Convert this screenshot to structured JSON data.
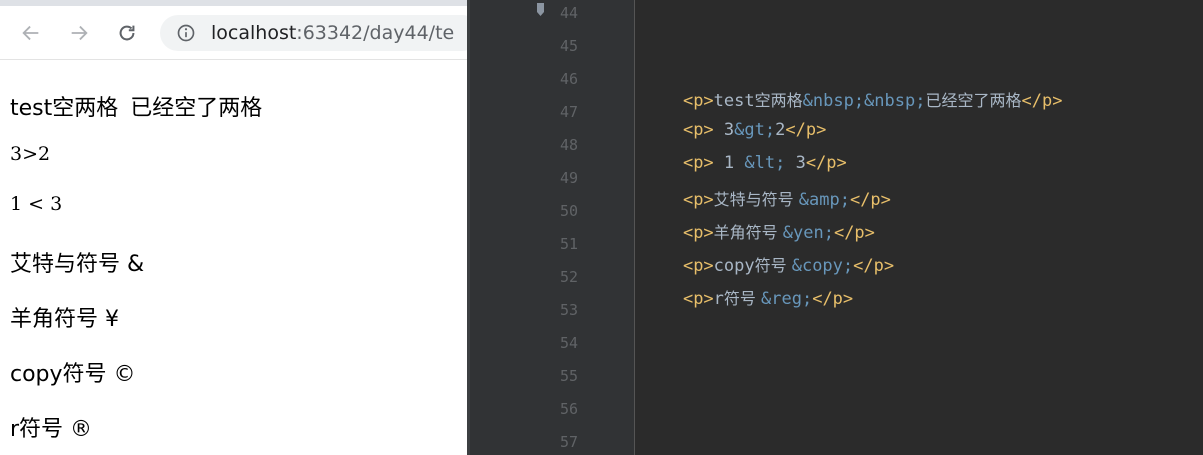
{
  "browser": {
    "url_host": "localhost",
    "url_path": ":63342/day44/te",
    "icons": {
      "back": "back-arrow-icon",
      "forward": "forward-arrow-icon",
      "reload": "reload-icon",
      "site_info": "info-icon"
    },
    "content": [
      {
        "before": "test空两格",
        "after": "已经空了两格"
      },
      {
        "text": "3>2"
      },
      {
        "text": "1 < 3"
      },
      {
        "text": "艾特与符号 &"
      },
      {
        "text": "羊角符号 ¥"
      },
      {
        "text": "copy符号 ©"
      },
      {
        "text": "r符号 ®"
      }
    ]
  },
  "editor": {
    "line_numbers": [
      "44",
      "45",
      "46",
      "47",
      "48",
      "49",
      "50",
      "51",
      "52",
      "53",
      "54",
      "55",
      "56",
      "57"
    ],
    "lines": [
      {
        "l46_open": "<p>",
        "l46_t1": "test",
        "l46_t2": "空两格",
        "l46_e": "&nbsp;&nbsp;",
        "l46_t3": "已经空了两格",
        "l46_close": "</p>"
      },
      {
        "open": "<p>",
        "pre": " 3",
        "ent": "&gt;",
        "post": "2",
        "close": "</p>"
      },
      {
        "open": "<p>",
        "pre": " 1 ",
        "ent": "&lt;",
        "post": " 3",
        "close": "</p>"
      },
      {
        "open": "<p>",
        "pre": "艾特与符号 ",
        "ent": "&amp;",
        "post": "",
        "close": "</p>"
      },
      {
        "open": "<p>",
        "pre": "羊角符号 ",
        "ent": "&yen;",
        "post": "",
        "close": "</p>"
      },
      {
        "open": "<p>",
        "pre": "copy",
        "pre2": "符号 ",
        "ent": "&copy;",
        "post": "",
        "close": "</p>"
      },
      {
        "open": "<p>",
        "pre": "r",
        "pre2": "符号 ",
        "ent": "&reg;",
        "post": "",
        "close": "</p>"
      }
    ]
  },
  "colors": {
    "editor_bg": "#2b2b2b",
    "gutter_bg": "#313335",
    "line_number": "#606366",
    "tag": "#e8bf6a",
    "entity": "#6897bb",
    "text": "#a9b7c6"
  }
}
